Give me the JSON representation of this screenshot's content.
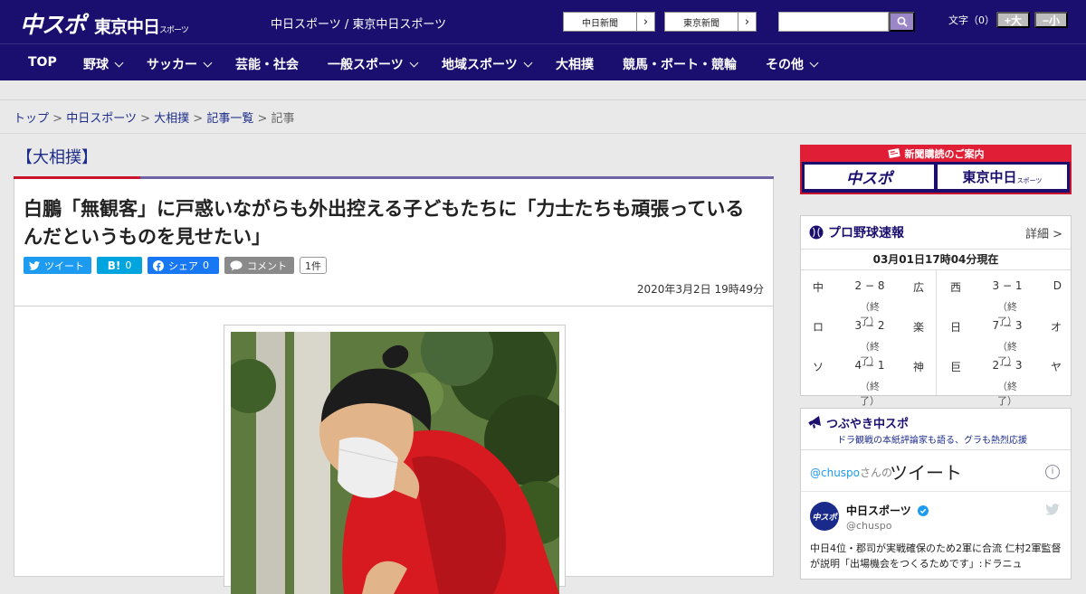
{
  "header": {
    "logo_main": "中スポ",
    "logo_sub": "東京中日",
    "logo_sub_small": "スポーツ",
    "site_title": "中日スポーツ / 東京中日スポーツ",
    "paper_buttons": [
      "中日新聞",
      "東京新聞"
    ],
    "search_placeholder": "",
    "font_size_label": "文字（0）",
    "font_bigger": "+大",
    "font_smaller": "−小"
  },
  "nav": {
    "items": [
      {
        "label": "TOP",
        "has_menu": false
      },
      {
        "label": "野球",
        "has_menu": true
      },
      {
        "label": "サッカー",
        "has_menu": true
      },
      {
        "label": "芸能・社会",
        "has_menu": false
      },
      {
        "label": "一般スポーツ",
        "has_menu": true
      },
      {
        "label": "地域スポーツ",
        "has_menu": true
      },
      {
        "label": "大相撲",
        "has_menu": false
      },
      {
        "label": "競馬・ボート・競輪",
        "has_menu": false
      },
      {
        "label": "その他",
        "has_menu": true
      }
    ]
  },
  "breadcrumb": {
    "items": [
      "トップ",
      "中日スポーツ",
      "大相撲",
      "記事一覧"
    ],
    "current": "記事",
    "sep": ">"
  },
  "article": {
    "section": "【大相撲】",
    "headline": "白鵬「無観客」に戸惑いながらも外出控える子どもたちに「力士たちも頑張っているんだというものを見せたい」",
    "share": {
      "tweet": "ツイート",
      "hatena_count": "0",
      "fb_label": "シェア",
      "fb_count": "0",
      "comment": "コメント",
      "comment_count": "1件"
    },
    "pubdate": "2020年3月2日 19時49分"
  },
  "sidebar": {
    "subscribe": {
      "title": "新聞購読のご案内",
      "buttons": [
        "中スポ",
        "東京中日"
      ],
      "button_small": "スポーツ"
    },
    "baseball": {
      "title": "プロ野球速報",
      "detail": "詳細 >",
      "time": "03月01日17時04分現在",
      "games": [
        {
          "away": "中",
          "score": "2 − 8",
          "home": "広",
          "status": "（終了）"
        },
        {
          "away": "ロ",
          "score": "3 − 2",
          "home": "楽",
          "status": "（終了）"
        },
        {
          "away": "ソ",
          "score": "4 − 1",
          "home": "神",
          "status": "（終了）"
        },
        {
          "away": "西",
          "score": "3 − 1",
          "home": "D",
          "status": "（終了）"
        },
        {
          "away": "日",
          "score": "7 − 3",
          "home": "オ",
          "status": "（終了）"
        },
        {
          "away": "巨",
          "score": "2 − 3",
          "home": "ヤ",
          "status": "（終了）"
        }
      ]
    },
    "twitter": {
      "title": "つぶやき中スポ",
      "subtitle": "ドラ観戦の本紙評論家も語る、グラも熱烈応援",
      "handle": "@chuspo",
      "handle_suffix": "さんの",
      "label": "ツイート",
      "info": "i",
      "account_name": "中日スポーツ",
      "account_id": "@chuspo",
      "avatar_text": "中スポ",
      "tweet_text": "中日4位・郡司が実戦確保のため2軍に合流 仁村2軍監督が説明「出場機会をつくるためです」:ドラニュ"
    }
  },
  "colors": {
    "navy": "#1a0f6e",
    "red": "#c9142c",
    "twitter": "#1d9bf0",
    "facebook": "#1877f2",
    "hatena": "#00a4de"
  }
}
